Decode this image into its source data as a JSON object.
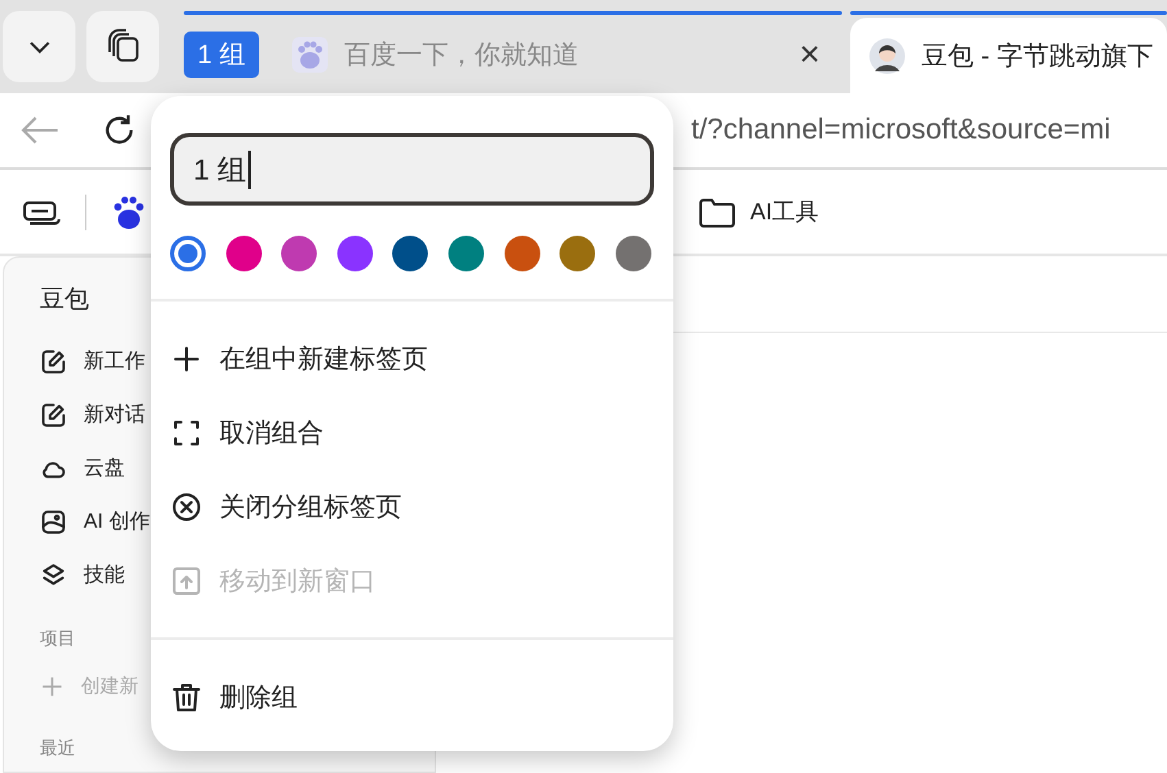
{
  "tab_strip": {
    "group_label": "1 组",
    "tabs": [
      {
        "title": "百度一下，你就知道",
        "selected": false,
        "close": "×"
      },
      {
        "title": "豆包 - 字节跳动旗下",
        "selected": true
      }
    ]
  },
  "address_bar": {
    "url": "t/?channel=microsoft&source=mi"
  },
  "bookmarks": [
    {
      "label": "AI工具"
    }
  ],
  "sidebar": {
    "title": "豆包",
    "items": [
      {
        "label": "新工作",
        "kind": "edit"
      },
      {
        "label": "新对话",
        "kind": "edit"
      },
      {
        "label": "云盘",
        "kind": "cloud"
      },
      {
        "label": "AI 创作",
        "kind": "image"
      },
      {
        "label": "技能",
        "kind": "layers"
      }
    ],
    "sections": [
      {
        "title": "项目",
        "items": [
          {
            "label": "创建新"
          }
        ]
      },
      {
        "title": "最近"
      }
    ]
  },
  "group_menu": {
    "name_field": {
      "value": "1 组"
    },
    "colors": [
      {
        "color": "#2b6fe6",
        "selected": true
      },
      {
        "color": "#e0008a",
        "selected": false
      },
      {
        "color": "#bf3ab0",
        "selected": false
      },
      {
        "color": "#8a33ff",
        "selected": false
      },
      {
        "color": "#004f8a",
        "selected": false
      },
      {
        "color": "#008080",
        "selected": false
      },
      {
        "color": "#c9500f",
        "selected": false
      },
      {
        "color": "#9a6e0f",
        "selected": false
      },
      {
        "color": "#747170",
        "selected": false
      }
    ],
    "sections": [
      [
        {
          "label": "在组中新建标签页",
          "kind": "add",
          "disabled": false
        },
        {
          "label": "取消组合",
          "kind": "ungroup",
          "disabled": false
        },
        {
          "label": "关闭分组标签页",
          "kind": "close",
          "disabled": false
        },
        {
          "label": "移动到新窗口",
          "kind": "move",
          "disabled": true
        }
      ],
      [
        {
          "label": "删除组",
          "kind": "delete",
          "disabled": false
        }
      ]
    ]
  }
}
